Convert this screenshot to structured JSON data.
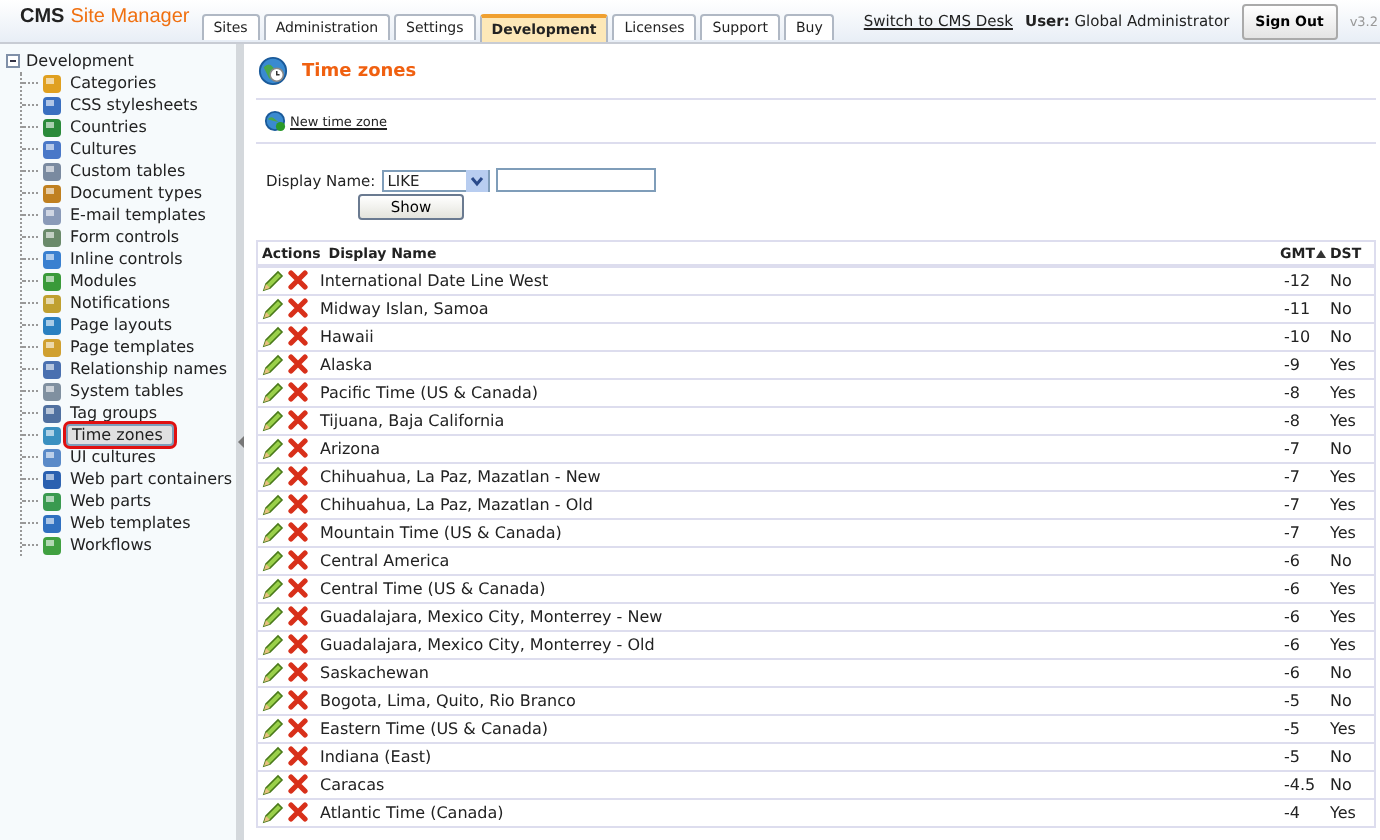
{
  "header": {
    "logo_main": "CMS",
    "logo_sub": "Site Manager",
    "switch_link": "Switch to CMS Desk",
    "user_label": "User:",
    "user_name": "Global Administrator",
    "sign_out": "Sign Out",
    "version": "v3.2"
  },
  "tabs": [
    {
      "label": "Sites",
      "selected": false
    },
    {
      "label": "Administration",
      "selected": false
    },
    {
      "label": "Settings",
      "selected": false
    },
    {
      "label": "Development",
      "selected": true
    },
    {
      "label": "Licenses",
      "selected": false
    },
    {
      "label": "Support",
      "selected": false
    },
    {
      "label": "Buy",
      "selected": false
    }
  ],
  "tree": {
    "label": "Development",
    "expanded": true,
    "children": [
      {
        "label": "Categories",
        "selected": false
      },
      {
        "label": "CSS stylesheets",
        "selected": false
      },
      {
        "label": "Countries",
        "selected": false
      },
      {
        "label": "Cultures",
        "selected": false
      },
      {
        "label": "Custom tables",
        "selected": false
      },
      {
        "label": "Document types",
        "selected": false
      },
      {
        "label": "E-mail templates",
        "selected": false
      },
      {
        "label": "Form controls",
        "selected": false
      },
      {
        "label": "Inline controls",
        "selected": false
      },
      {
        "label": "Modules",
        "selected": false
      },
      {
        "label": "Notifications",
        "selected": false
      },
      {
        "label": "Page layouts",
        "selected": false
      },
      {
        "label": "Page templates",
        "selected": false
      },
      {
        "label": "Relationship names",
        "selected": false
      },
      {
        "label": "System tables",
        "selected": false
      },
      {
        "label": "Tag groups",
        "selected": false
      },
      {
        "label": "Time zones",
        "selected": true
      },
      {
        "label": "UI cultures",
        "selected": false
      },
      {
        "label": "Web part containers",
        "selected": false
      },
      {
        "label": "Web parts",
        "selected": false
      },
      {
        "label": "Web templates",
        "selected": false
      },
      {
        "label": "Workflows",
        "selected": false
      }
    ]
  },
  "page": {
    "title": "Time zones",
    "new_link": "New time zone"
  },
  "filter": {
    "label": "Display Name:",
    "operator": "LIKE",
    "button": "Show"
  },
  "table": {
    "columns": [
      "Actions",
      "Display Name",
      "GMT",
      "DST"
    ],
    "rows": [
      {
        "name": "International Date Line West",
        "gmt": "-12",
        "dst": "No"
      },
      {
        "name": "Midway Islan, Samoa",
        "gmt": "-11",
        "dst": "No"
      },
      {
        "name": "Hawaii",
        "gmt": "-10",
        "dst": "No"
      },
      {
        "name": "Alaska",
        "gmt": "-9",
        "dst": "Yes"
      },
      {
        "name": "Pacific Time (US & Canada)",
        "gmt": "-8",
        "dst": "Yes"
      },
      {
        "name": "Tijuana, Baja California",
        "gmt": "-8",
        "dst": "Yes"
      },
      {
        "name": "Arizona",
        "gmt": "-7",
        "dst": "No"
      },
      {
        "name": "Chihuahua, La Paz, Mazatlan - New",
        "gmt": "-7",
        "dst": "Yes"
      },
      {
        "name": "Chihuahua, La Paz, Mazatlan - Old",
        "gmt": "-7",
        "dst": "Yes"
      },
      {
        "name": "Mountain Time (US & Canada)",
        "gmt": "-7",
        "dst": "Yes"
      },
      {
        "name": "Central America",
        "gmt": "-6",
        "dst": "No"
      },
      {
        "name": "Central Time (US & Canada)",
        "gmt": "-6",
        "dst": "Yes"
      },
      {
        "name": "Guadalajara, Mexico City, Monterrey - New",
        "gmt": "-6",
        "dst": "Yes"
      },
      {
        "name": "Guadalajara, Mexico City, Monterrey - Old",
        "gmt": "-6",
        "dst": "Yes"
      },
      {
        "name": "Saskachewan",
        "gmt": "-6",
        "dst": "No"
      },
      {
        "name": "Bogota, Lima, Quito, Rio Branco",
        "gmt": "-5",
        "dst": "No"
      },
      {
        "name": "Eastern Time (US & Canada)",
        "gmt": "-5",
        "dst": "Yes"
      },
      {
        "name": "Indiana (East)",
        "gmt": "-5",
        "dst": "No"
      },
      {
        "name": "Caracas",
        "gmt": "-4.5",
        "dst": "No"
      },
      {
        "name": "Atlantic Time (Canada)",
        "gmt": "-4",
        "dst": "Yes"
      }
    ]
  }
}
